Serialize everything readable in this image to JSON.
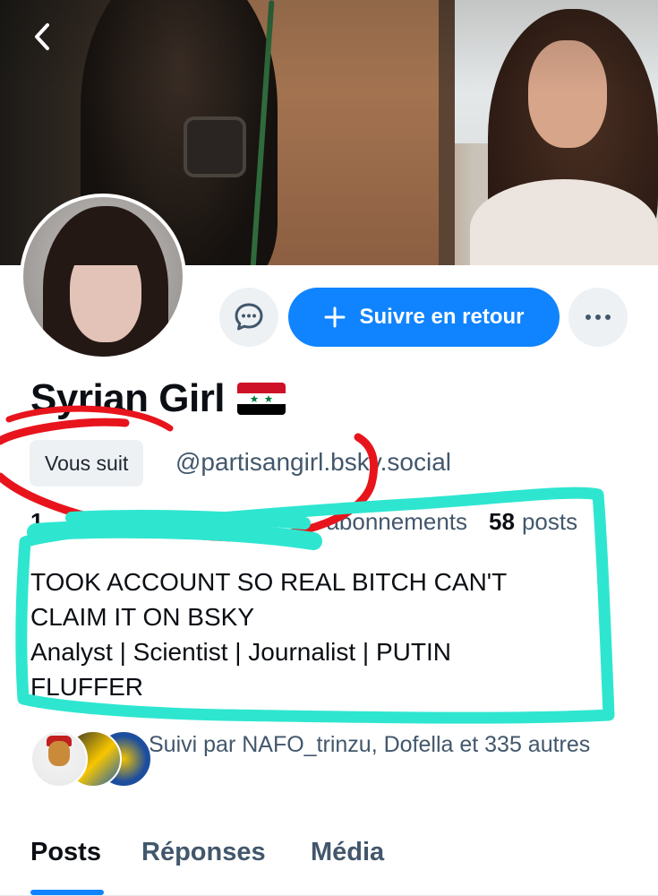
{
  "profile": {
    "display_name": "Syrian Girl",
    "flag_icon": "syria-flag-icon",
    "follows_you_label": "Vous suit",
    "handle": "@partisangirl.bsky.social",
    "stats": {
      "followers_count": "1",
      "following_label": "abonnements",
      "posts_count": "58",
      "posts_label": "posts"
    },
    "bio": "TOOK ACCOUNT SO REAL BITCH CAN'T\nCLAIM IT ON BSKY\nAnalyst | Scientist | Journalist | PUTIN\nFLUFFER"
  },
  "actions": {
    "message_icon": "chat-bubble-icon",
    "follow_back_label": "Suivre en retour",
    "more_icon": "ellipsis-icon"
  },
  "followed_by": {
    "text": "Suivi par NAFO_trinzu, Dofella et 335 autres"
  },
  "tabs": [
    {
      "label": "Posts",
      "active": true
    },
    {
      "label": "Réponses",
      "active": false
    },
    {
      "label": "Média",
      "active": false
    }
  ],
  "colors": {
    "accent": "#1083fe",
    "annotation_red": "#e8141c",
    "annotation_teal": "#2ee6cf",
    "muted_text": "#42576c"
  }
}
